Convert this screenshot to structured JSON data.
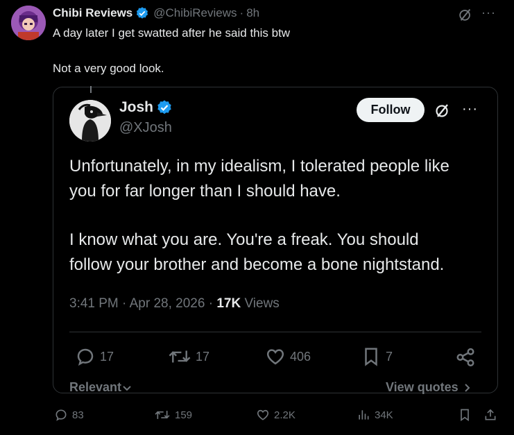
{
  "outer_tweet": {
    "author_name": "Chibi Reviews",
    "author_handle": "@ChibiReviews",
    "separator": "·",
    "time_ago": "8h",
    "text_line1": "A day later I get swatted after he said this btw",
    "text_line2": "Not a very good look.",
    "more": "···",
    "actions": {
      "replies": "83",
      "reposts": "159",
      "likes": "2.2K",
      "views": "34K"
    }
  },
  "quoted_tweet": {
    "author_name": "Josh",
    "author_handle": "@XJosh",
    "follow_label": "Follow",
    "more": "···",
    "text_lines": [
      "Unfortunately, in my idealism, I tolerated people like",
      "you for far longer than I should have.",
      "I know what you are. You're a freak. You should",
      "follow your brother and become a bone nightstand."
    ],
    "time": "3:41 PM",
    "date": "Apr 28, 2026",
    "views_count": "17K",
    "views_label": "Views",
    "actions": {
      "replies": "17",
      "reposts": "17",
      "likes": "406",
      "bookmarks": "7"
    },
    "relevant_label": "Relevant",
    "view_quotes_label": "View quotes"
  },
  "colors": {
    "background": "#000000",
    "text": "#e7e9ea",
    "muted": "#71767b",
    "verified": "#1d9bf0",
    "border": "#2f3336"
  }
}
